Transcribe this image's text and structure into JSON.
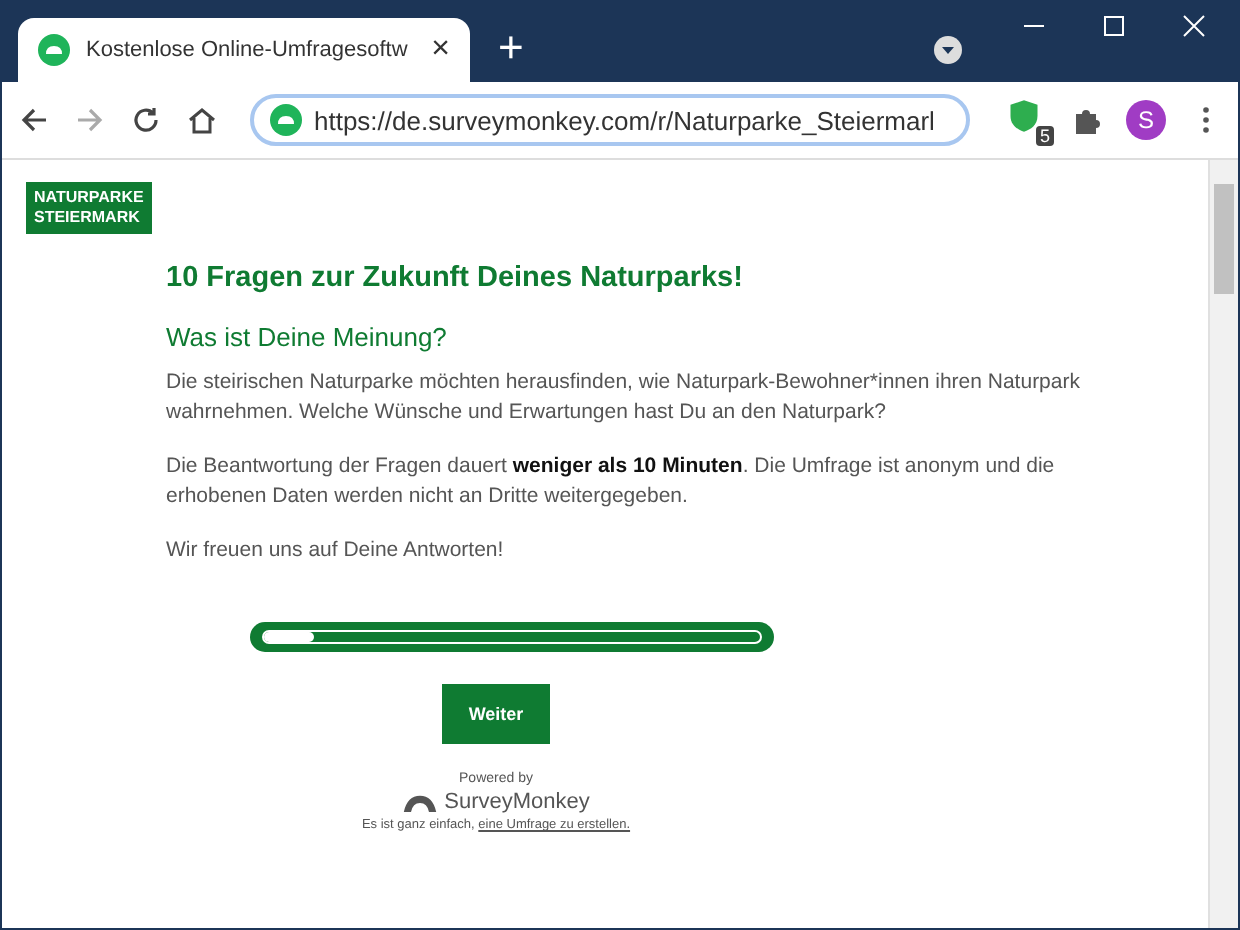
{
  "browser": {
    "tab": {
      "title": "Kostenlose Online-Umfragesoftw",
      "close": "×"
    },
    "new_tab": "+",
    "url": "https://de.surveymonkey.com/r/Naturparke_Steiermarl",
    "extension_badge": "5",
    "profile_initial": "S"
  },
  "logo": {
    "lines": [
      "NATURPARKE",
      "STEIERMARK"
    ]
  },
  "survey": {
    "title": "10 Fragen zur Zukunft Deines Naturparks!",
    "subtitle": "Was ist Deine Meinung?",
    "paragraphs": [
      "Die steirischen Naturparke möchten herausfinden, wie Naturpark-Bewohner*innen ihren Naturpark wahrnehmen. Welche Wünsche und Erwartungen hast Du an den Naturpark?",
      "Die Beantwortung der Fragen dauert **weniger als 10 Minuten**. Die Umfrage ist anonym und die erhobenen Daten werden nicht an Dritte weitergegeben.",
      "Wir freuen uns auf Deine Antworten!"
    ],
    "progress": {
      "level": 0.1
    },
    "next_button": "Weiter"
  },
  "footer": {
    "powered_by": "Powered by",
    "brand": "SurveyMonkey",
    "note": "Es ist ganz einfach,",
    "link": "eine Umfrage zu erstellen."
  }
}
